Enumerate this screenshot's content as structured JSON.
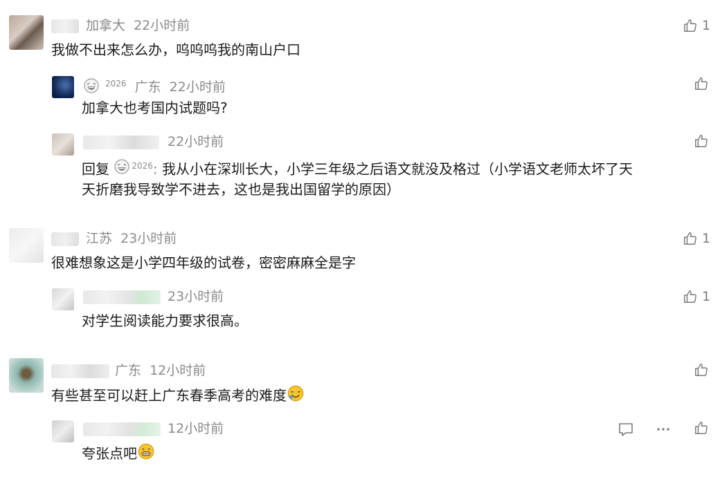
{
  "comments": [
    {
      "location": "加拿大",
      "time": "22小时前",
      "likes": "1",
      "text": "我做不出来怎么办，呜呜呜我的南山户口",
      "replies": [
        {
          "badge": "2026",
          "location": "广东",
          "time": "22小时前",
          "likes": "",
          "text": "加拿大也考国内试题吗?"
        },
        {
          "time": "22小时前",
          "likes": "",
          "reply_prefix": "回复",
          "reply_badge": "2026",
          "text_line1": "我从小在深圳长大，小学三年级之后语文就没及格过（小学语文老师太坏了天",
          "text_line2": "天折磨我导致学不进去，这也是我出国留学的原因）"
        }
      ]
    },
    {
      "location": "江苏",
      "time": "23小时前",
      "likes": "1",
      "text": "很难想象这是小学四年级的试卷，密密麻麻全是字",
      "replies": [
        {
          "time": "23小时前",
          "likes": "1",
          "text": "对学生阅读能力要求很高。"
        }
      ]
    },
    {
      "location": "广东",
      "time": "12小时前",
      "likes": "",
      "text": "有些甚至可以赶上广东春季高考的难度",
      "replies": [
        {
          "time": "12小时前",
          "likes": "",
          "text": "夸张点吧"
        }
      ]
    }
  ],
  "icons": {
    "like": "thumbs-up-icon",
    "comment": "comment-icon",
    "more": "more-icon",
    "badge": "laughing-emoji-icon"
  },
  "colors": {
    "meta": "#8a8a8a",
    "text": "#1a1a1a",
    "icon": "#7a7a7a"
  }
}
